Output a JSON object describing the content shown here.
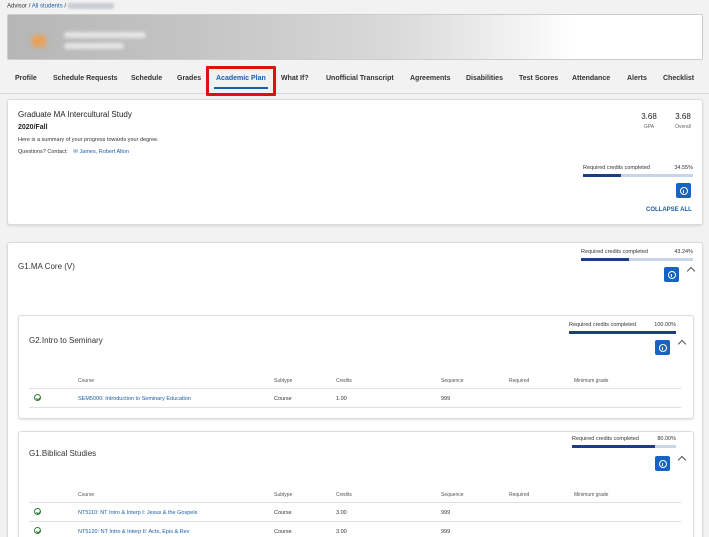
{
  "breadcrumb": {
    "advisor": "Advisor",
    "separator": "/",
    "all_students": "All students",
    "separator2": "/"
  },
  "tabs": [
    {
      "label": "Profile"
    },
    {
      "label": "Schedule Requests"
    },
    {
      "label": "Schedule"
    },
    {
      "label": "Grades"
    },
    {
      "label": "Academic Plan"
    },
    {
      "label": "What If?"
    },
    {
      "label": "Unofficial Transcript"
    },
    {
      "label": "Agreements"
    },
    {
      "label": "Disabilities"
    },
    {
      "label": "Test Scores"
    },
    {
      "label": "Attendance"
    },
    {
      "label": "Alerts"
    },
    {
      "label": "Checklist"
    }
  ],
  "program": {
    "title": "Graduate MA Intercultural Study",
    "term": "2020/Fall",
    "summary": "Here is a summary of your progress towards your degree.",
    "contact_label": "Questions? Contact:",
    "contact_name": "James, Robert Alton",
    "gpa_value": "3.68",
    "gpa_label": "GPA",
    "overall_value": "3.68",
    "overall_label": "Overall",
    "credits_label": "Required credits completed",
    "credits_pct": "34.55%",
    "credits_fraction": 0.3455,
    "collapse_all": "COLLAPSE ALL"
  },
  "core": {
    "title": "G1.MA Core (V)",
    "credits_label": "Required credits completed",
    "credits_pct": "43.24%",
    "credits_fraction": 0.4324
  },
  "table_headers": {
    "course": "Course",
    "subtype": "Subtype",
    "credits": "Credits",
    "sequence": "Sequence",
    "required": "Required",
    "minimum_grade": "Minimum grade"
  },
  "seminary": {
    "title": "G2.Intro to Seminary",
    "credits_label": "Required credits completed",
    "credits_pct": "100.00%",
    "credits_fraction": 1.0,
    "rows": [
      {
        "course": "SEM5000: Introduction to Seminary Education",
        "subtype": "Course",
        "credits": "1.00",
        "sequence": "999"
      }
    ]
  },
  "biblical": {
    "title": "G1.Biblical Studies",
    "credits_label": "Required credits completed",
    "credits_pct": "80.00%",
    "credits_fraction": 0.8,
    "rows": [
      {
        "course": "NT5110: NT Intro & Interp I: Jesus & the Gospels",
        "subtype": "Course",
        "credits": "3.00",
        "sequence": "999"
      },
      {
        "course": "NT5120: NT Intro & Interp II: Acts, Epis & Rev",
        "subtype": "Course",
        "credits": "3.00",
        "sequence": "999"
      }
    ]
  }
}
